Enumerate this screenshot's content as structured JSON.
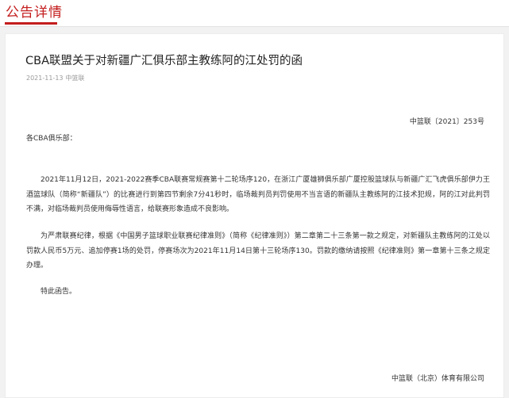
{
  "header": {
    "title": "公告详情"
  },
  "article": {
    "title": "CBA联盟关于对新疆广汇俱乐部主教练阿的江处罚的函",
    "date": "2021-11-13",
    "source": "中篮联",
    "doc_number": "中篮联〔2021〕253号",
    "salutation": "各CBA俱乐部：",
    "paragraphs": [
      "2021年11月12日，2021-2022赛季CBA联赛常规赛第十二轮场序120，在浙江广厦雄狮俱乐部广厦控股篮球队与新疆广汇飞虎俱乐部伊力王酒篮球队（简称“新疆队”）的比赛进行到第四节剩余7分41秒时，临场裁判员判罚使用不当言语的新疆队主教练阿的江技术犯规，阿的江对此判罚不满，对临场裁判员使用侮辱性语言，给联赛形象造成不良影响。",
      "为严肃联赛纪律，根据《中国男子篮球职业联赛纪律准则》（简称《纪律准则》）第二章第二十三条第一款之规定，对新疆队主教练阿的江处以罚款人民币5万元、追加停赛1场的处罚，停赛场次为2021年11月14日第十三轮场序130。罚款的缴纳请按照《纪律准则》第一章第十三条之规定办理。",
      "特此函告。"
    ],
    "signature": "中篮联（北京）体育有限公司"
  },
  "colors": {
    "accent": "#c41d1d",
    "page_background": "#f2f2f2",
    "card_background": "#ffffff"
  }
}
